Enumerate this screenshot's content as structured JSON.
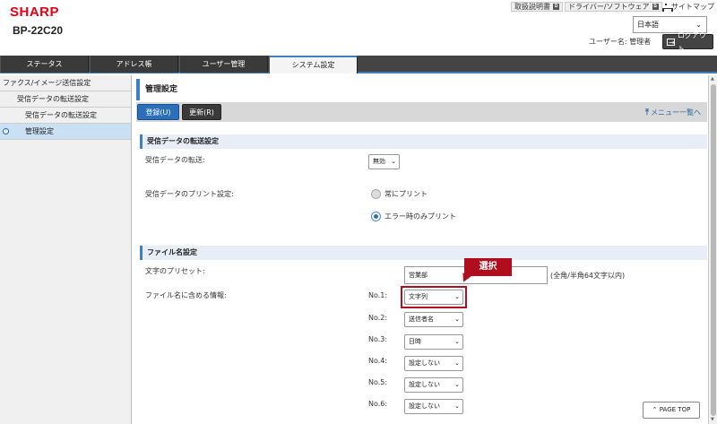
{
  "header": {
    "logo": "SHARP",
    "model": "BP-22C20",
    "links": [
      "取扱説明書",
      "ドライバー/ソフトウェア"
    ],
    "sitemap": "サイトマップ",
    "language": "日本語",
    "username": "ユーザー名: 管理者",
    "logout": "ログアウト"
  },
  "tabs": [
    "ステータス",
    "アドレス帳",
    "ユーザー管理",
    "システム設定"
  ],
  "sidebar": {
    "items": [
      "ファクス/イメージ送信設定",
      "受信データの転送設定",
      "受信データの転送設定",
      "管理設定"
    ]
  },
  "main": {
    "title": "管理設定",
    "save_button": "登録(U)",
    "refresh_button": "更新(R)",
    "menu_link": "メニュー一覧へ",
    "section1": {
      "title": "受信データの転送設定",
      "transfer_label": "受信データの転送:",
      "transfer_value": "無効",
      "print_label": "受信データのプリント設定:",
      "print_options": [
        "常にプリント",
        "エラー時のみプリント"
      ]
    },
    "section2": {
      "title": "ファイル名設定",
      "preset_label": "文字のプリセット:",
      "preset_value": "営業部",
      "preset_hint": "(全角/半角64文字以内)",
      "include_label": "ファイル名に含める情報:",
      "rows": [
        {
          "no": "No.1:",
          "value": "文字列"
        },
        {
          "no": "No.2:",
          "value": "送信者名"
        },
        {
          "no": "No.3:",
          "value": "日時"
        },
        {
          "no": "No.4:",
          "value": "設定しない"
        },
        {
          "no": "No.5:",
          "value": "設定しない"
        },
        {
          "no": "No.6:",
          "value": "設定しない"
        }
      ]
    },
    "callout": "選択",
    "page_top": "PAGE TOP"
  },
  "colors": {
    "brand": "#e60012",
    "accent": "#3f7fbf",
    "callout": "#b00d1f"
  }
}
